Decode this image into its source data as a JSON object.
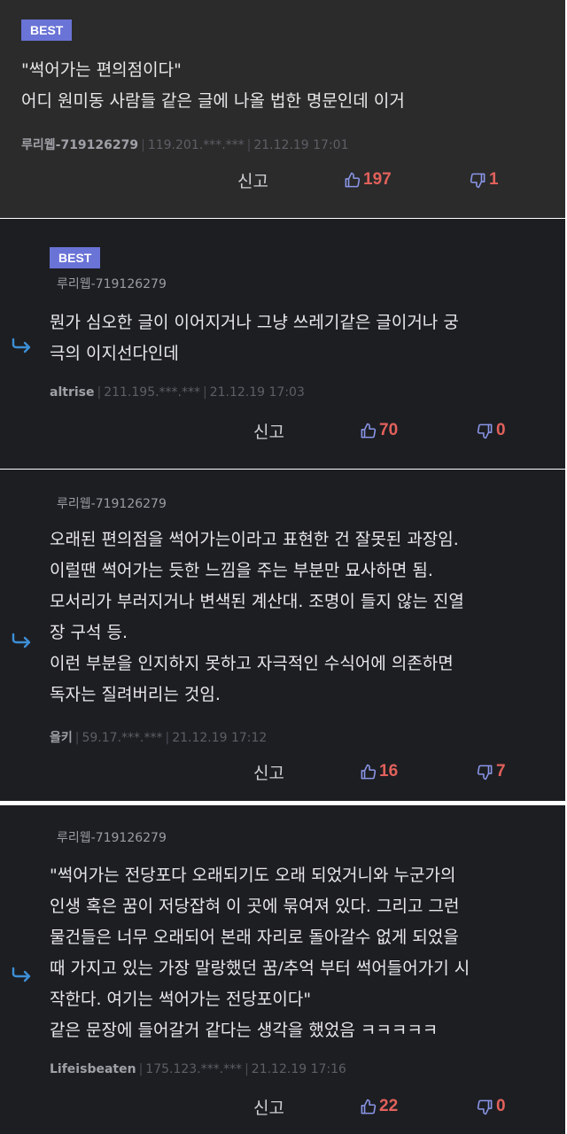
{
  "comments": [
    {
      "badge": "BEST",
      "body": "\"썩어가는 편의점이다\"\n어디 원미동 사람들 같은 글에 나올 법한 명문인데 이거",
      "author": "루리웹-719126279",
      "ip": "119.201.***.***",
      "date": "21.12.19 17:01",
      "report": "신고",
      "up": "197",
      "down": "1"
    },
    {
      "badge": "BEST",
      "reply_to": "루리웹-719126279",
      "body": "뭔가 심오한 글이 이어지거나 그냥 쓰레기같은 글이거나 궁\n극의 이지선다인데",
      "author": "altrise",
      "ip": "211.195.***.***",
      "date": "21.12.19 17:03",
      "report": "신고",
      "up": "70",
      "down": "0"
    },
    {
      "reply_to": "루리웹-719126279",
      "body": "오래된 편의점을 썩어가는이라고 표현한 건 잘못된 과장임.\n이럴땐 썩어가는 듯한 느낌을 주는 부분만 묘사하면 됨.\n모서리가 부러지거나 변색된 계산대. 조명이 들지 않는 진열\n장 구석 등.\n이런 부분을 인지하지 못하고 자극적인 수식어에 의존하면\n독자는 질려버리는 것임.",
      "author": "을키",
      "ip": "59.17.***.***",
      "date": "21.12.19 17:12",
      "report": "신고",
      "up": "16",
      "down": "7"
    },
    {
      "reply_to": "루리웹-719126279",
      "body": "\"썩어가는 전당포다 오래되기도 오래 되었거니와 누군가의\n인생 혹은 꿈이 저당잡혀 이 곳에 묶여져 있다. 그리고 그런\n물건들은 너무 오래되어 본래 자리로 돌아갈수 없게 되었을\n때 가지고 있는 가장 말랑했던 꿈/추억 부터 썩어들어가기 시\n작한다. 여기는 썩어가는 전당포이다\"\n같은 문장에 들어갈거 같다는 생각을 했었음 ㅋㅋㅋㅋㅋ",
      "author": "Lifeisbeaten",
      "ip": "175.123.***.***",
      "date": "21.12.19 17:16",
      "report": "신고",
      "up": "22",
      "down": "0"
    }
  ],
  "colors": {
    "badge": "#6a73d6",
    "panel_best": "#2b2b2b",
    "panel": "#1d1e22",
    "vote_count": "#e2615b",
    "vote_icon": "#8a96e8",
    "reply_arrow": "#3d8fd6"
  },
  "icons": {
    "thumbs_up": "thumbs-up-icon",
    "thumbs_down": "thumbs-down-icon",
    "reply": "reply-arrow-icon"
  }
}
